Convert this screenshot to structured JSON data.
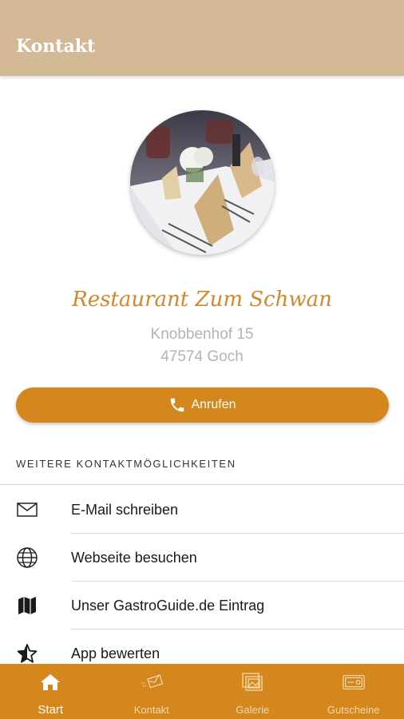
{
  "header": {
    "title": "Kontakt"
  },
  "restaurant": {
    "name": "Restaurant Zum Schwan",
    "address_line1": "Knobbenhof 15",
    "address_line2": "47574 Goch"
  },
  "call_button": {
    "label": "Anrufen",
    "icon": "phone-icon"
  },
  "section": {
    "title": "WEITERE KONTAKTMÖGLICHKEITEN"
  },
  "contact_items": [
    {
      "label": "E-Mail schreiben",
      "icon": "mail-icon"
    },
    {
      "label": "Webseite besuchen",
      "icon": "globe-icon"
    },
    {
      "label": "Unser GastroGuide.de Eintrag",
      "icon": "map-icon"
    },
    {
      "label": "App bewerten",
      "icon": "star-icon"
    }
  ],
  "bottom_nav": [
    {
      "label": "Start",
      "icon": "home-icon",
      "active": true
    },
    {
      "label": "Kontakt",
      "icon": "contact-icon",
      "active": false
    },
    {
      "label": "Galerie",
      "icon": "gallery-icon",
      "active": false
    },
    {
      "label": "Gutscheine",
      "icon": "voucher-icon",
      "active": false
    }
  ],
  "colors": {
    "header_bg": "#d4b996",
    "accent": "#d4871d",
    "name_color": "#d4872a",
    "address_color": "#b3b3b3"
  }
}
